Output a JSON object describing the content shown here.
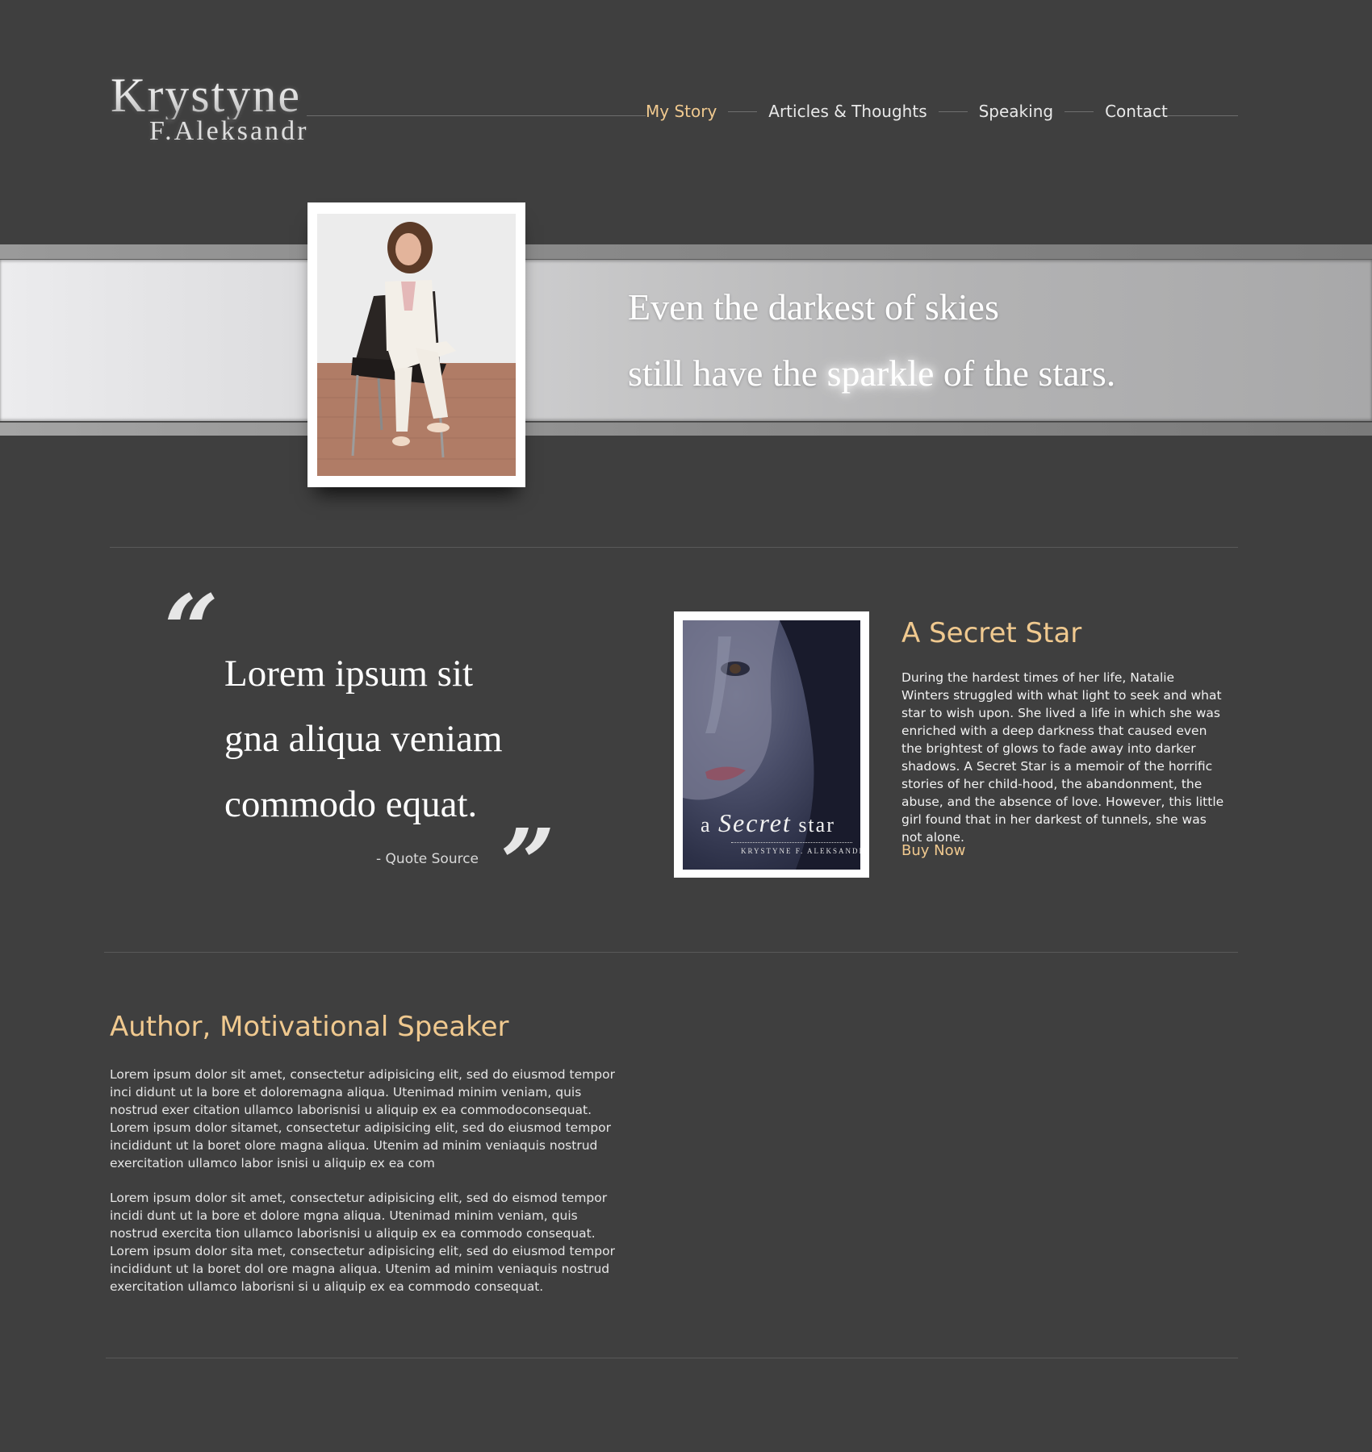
{
  "brand": {
    "first_name": "Krystyne",
    "last_name": "F.Aleksandr"
  },
  "nav": {
    "items": [
      {
        "label": "My Story",
        "active": true
      },
      {
        "label": "Articles & Thoughts",
        "active": false
      },
      {
        "label": "Speaking",
        "active": false
      },
      {
        "label": "Contact",
        "active": false
      }
    ]
  },
  "hero": {
    "line1": "Even the darkest of skies",
    "line2_before": "still have the ",
    "line2_highlight": "sparkle",
    "line2_after": " of the stars."
  },
  "quote": {
    "open_mark": "“",
    "close_mark": "”",
    "lines": [
      "Lorem ipsum sit",
      "gna aliqua veniam",
      "commodo equat."
    ],
    "source": "- Quote Source"
  },
  "book": {
    "cover": {
      "title_prefix": "a ",
      "title_main": "Secret",
      "title_suffix": " star",
      "author": "KRYSTYNE F. ALEKSANDR"
    },
    "title": "A Secret Star",
    "description": "During the hardest times of her life, Natalie Winters struggled with what light to seek and what star to wish upon. She lived a life in which she was enriched with a deep darkness that caused even the brightest of glows to fade away into darker shadows. A Secret Star is a memoir of the horrific stories of her child-hood, the abandonment, the abuse, and the absence of love. However, this little girl found that in her darkest of tunnels, she was not alone.",
    "cta": "Buy Now"
  },
  "about": {
    "heading": "Author, Motivational Speaker",
    "paragraphs": [
      "Lorem ipsum dolor sit amet, consectetur adipisicing elit, sed do eiusmod tempor inci didunt ut la bore et doloremagna aliqua. Utenimad minim veniam, quis nostrud exer citation ullamco laborisnisi u aliquip ex ea commodoconsequat.  Lorem ipsum dolor sitamet, consectetur adipisicing elit, sed do eiusmod tempor incididunt ut la boret olore magna aliqua. Utenim ad minim veniaquis nostrud exercitation ullamco labor isnisi u aliquip ex ea com",
      "Lorem ipsum dolor sit amet, consectetur adipisicing elit, sed do eismod tempor incidi dunt ut la bore et dolore mgna aliqua. Utenimad minim veniam, quis nostrud exercita tion ullamco laborisnisi u aliquip ex ea commodo consequat.  Lorem ipsum dolor sita met, consectetur adipisicing elit, sed do eiusmod tempor incididunt ut la boret dol ore magna aliqua. Utenim ad minim veniaquis nostrud exercitation ullamco laborisni si u aliquip ex ea commodo consequat."
    ]
  },
  "colors": {
    "background": "#3f3f3f",
    "accent": "#f0c98f",
    "text": "#ececec"
  }
}
